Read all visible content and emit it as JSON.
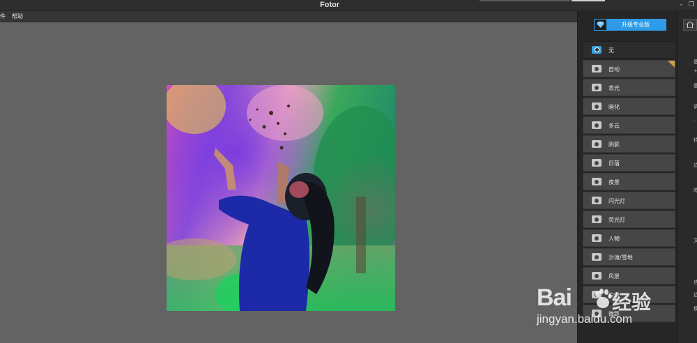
{
  "window": {
    "title": "Fotor",
    "minimize_glyph": "–",
    "restore_glyph": "❐",
    "close_glyph": "✕"
  },
  "menu": {
    "items": [
      "件",
      "帮助"
    ]
  },
  "sidebar": {
    "upgrade_label": "升级专业版",
    "scenes": [
      {
        "label": "无",
        "icon": "none-icon",
        "active": true
      },
      {
        "label": "自动",
        "icon": "camera-icon",
        "active": false
      },
      {
        "label": "背光",
        "icon": "backlight-icon",
        "active": false
      },
      {
        "label": "暗化",
        "icon": "darken-icon",
        "active": false
      },
      {
        "label": "多云",
        "icon": "cloud-icon",
        "active": false
      },
      {
        "label": "阴影",
        "icon": "shadow-icon",
        "active": false
      },
      {
        "label": "日落",
        "icon": "sunset-icon",
        "active": false
      },
      {
        "label": "夜景",
        "icon": "night-icon",
        "active": false
      },
      {
        "label": "闪光灯",
        "icon": "flash-icon",
        "active": false
      },
      {
        "label": "荧光灯",
        "icon": "fluorescent-icon",
        "active": false
      },
      {
        "label": "人物",
        "icon": "portrait-icon",
        "active": false
      },
      {
        "label": "沙滩/雪地",
        "icon": "beach-snow-icon",
        "active": false
      },
      {
        "label": "风景",
        "icon": "landscape-icon",
        "active": false
      },
      {
        "label": "白炽",
        "icon": "incandescent-icon",
        "active": false
      },
      {
        "label": "微距",
        "icon": "macro-icon",
        "active": false
      }
    ]
  },
  "right_strip": {
    "chars": [
      "基",
      "+",
      "调",
      "-",
      "特",
      "边",
      "暗",
      "文",
      "信",
      "边",
      "模",
      "导"
    ]
  },
  "watermark": {
    "logo": "Bai",
    "logo_tail": "经验",
    "url": "jingyan.baidu.com"
  },
  "colors": {
    "accent": "#2f9be8",
    "background": "#636363",
    "panel": "#262626",
    "item": "#464646"
  }
}
